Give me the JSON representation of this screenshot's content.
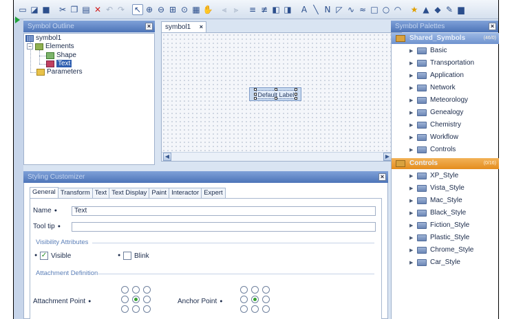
{
  "toolbar": {
    "icons": [
      "new-icon",
      "open-icon",
      "save-icon",
      "cut-icon",
      "copy-icon",
      "paste-icon",
      "delete-icon",
      "undo-icon",
      "redo-icon",
      "select-icon",
      "zoom-in-icon",
      "zoom-out-icon",
      "zoom-fit-icon",
      "zoom-region-icon",
      "grid-icon",
      "pan-icon",
      "align-left-icon",
      "align-right-icon",
      "group-icon",
      "ungroup-icon",
      "front-icon",
      "back-icon",
      "text-icon",
      "line-icon",
      "polyline-icon",
      "polygon-icon",
      "curve-icon",
      "freeform-icon",
      "rectangle-icon",
      "ellipse-icon",
      "arc-icon",
      "star-icon",
      "fill-icon",
      "color-icon",
      "stroke-icon",
      "display-icon"
    ],
    "text_tool": "A"
  },
  "outline": {
    "title": "Symbol Outline",
    "tree": {
      "root": "symbol1",
      "elements": "Elements",
      "shape": "Shape",
      "text": "Text",
      "parameters": "Parameters"
    }
  },
  "editor": {
    "tab_label": "symbol1",
    "node_label": "Default Label"
  },
  "customizer": {
    "title": "Styling Customizer",
    "tabs": [
      "General",
      "Transform",
      "Text",
      "Text Display",
      "Paint",
      "Interactor",
      "Expert"
    ],
    "name_label": "Name",
    "name_value": "Text",
    "tooltip_label": "Tool tip",
    "tooltip_value": "",
    "visibility_title": "Visibility Attributes",
    "visible_label": "Visible",
    "visible_checked": true,
    "blink_label": "Blink",
    "blink_checked": false,
    "attachment_title": "Attachment Definition",
    "attachment_point_label": "Attachment Point",
    "anchor_point_label": "Anchor Point"
  },
  "palettes": {
    "title": "Symbol Palettes",
    "groups": [
      {
        "label": "Shared_Symbols",
        "count": "(46/0)",
        "items": [
          "Basic",
          "Transportation",
          "Application",
          "Network",
          "Meteorology",
          "Genealogy",
          "Chemistry",
          "Workflow",
          "Controls"
        ]
      },
      {
        "label": "Controls",
        "count": "(0/16)",
        "items": [
          "XP_Style",
          "Vista_Style",
          "Mac_Style",
          "Black_Style",
          "Fiction_Style",
          "Plastic_Style",
          "Chrome_Style",
          "Car_Style"
        ]
      }
    ]
  },
  "colors": {
    "header_blue": "#4d74b8",
    "group_orange": "#e48d1e",
    "radio_green": "#35a02f"
  }
}
